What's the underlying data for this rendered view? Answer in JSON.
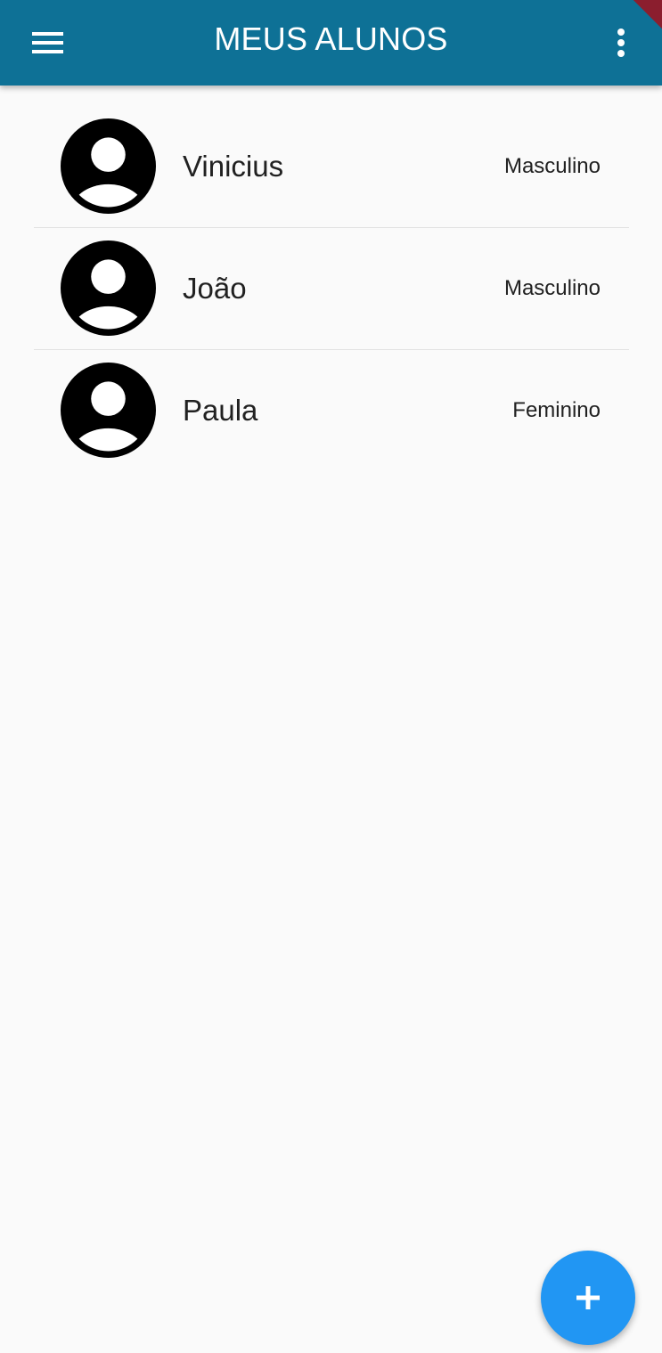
{
  "app_bar": {
    "title": "MEUS ALUNOS",
    "background_color": "#0e7196",
    "leading_icon": "menu-icon",
    "trailing_icon": "more-vert-icon"
  },
  "students": [
    {
      "name": "Vinicius",
      "gender": "Masculino",
      "avatar_icon": "account-circle-icon"
    },
    {
      "name": "João",
      "gender": "Masculino",
      "avatar_icon": "account-circle-icon"
    },
    {
      "name": "Paula",
      "gender": "Feminino",
      "avatar_icon": "account-circle-icon"
    }
  ],
  "fab": {
    "icon": "add-icon",
    "color": "#2196f3"
  }
}
